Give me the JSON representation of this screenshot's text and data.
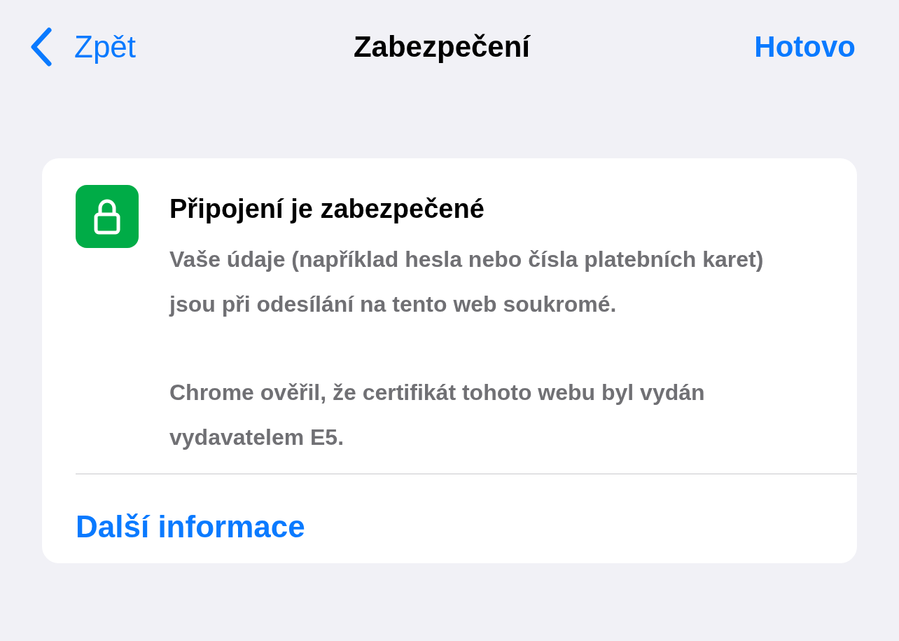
{
  "nav": {
    "back": "Zpět",
    "title": "Zabezpečení",
    "done": "Hotovo"
  },
  "card": {
    "secure": true,
    "title": "Připojení je zabezpečené",
    "paragraphs": [
      "Vaše údaje (například hesla nebo čísla platebních karet) jsou při odesílání na tento web soukromé.",
      "Chrome ověřil, že certifikát tohoto webu byl vydán vydavatelem E5."
    ],
    "link": "Další informace"
  }
}
